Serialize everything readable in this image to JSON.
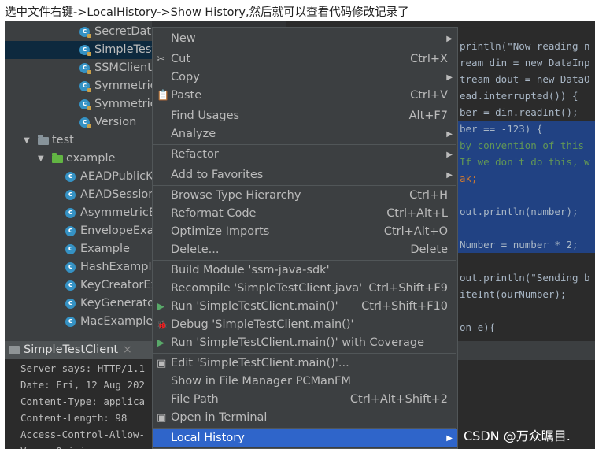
{
  "caption": "选中文件右键->LocalHistory->Show History,然后就可以查看代码修改记录了",
  "tree": {
    "items": [
      {
        "label": "SecretData",
        "kind": "class",
        "lock": true,
        "selected": false
      },
      {
        "label": "SimpleTest",
        "kind": "class",
        "lock": true,
        "selected": true
      },
      {
        "label": "SSMClient",
        "kind": "class",
        "lock": true,
        "selected": false
      },
      {
        "label": "Symmetric",
        "kind": "class",
        "lock": true,
        "selected": false
      },
      {
        "label": "Symmetric",
        "kind": "class",
        "lock": true,
        "selected": false
      },
      {
        "label": "Version",
        "kind": "class",
        "lock": true,
        "selected": false
      },
      {
        "label": "test",
        "kind": "folder",
        "expanded": true
      },
      {
        "label": "example",
        "kind": "folder",
        "expanded": true
      },
      {
        "label": "AEADPublicK",
        "kind": "class",
        "lock": false
      },
      {
        "label": "AEADSession",
        "kind": "class",
        "lock": false
      },
      {
        "label": "AsymmetricE",
        "kind": "class",
        "lock": false
      },
      {
        "label": "EnvelopeExar",
        "kind": "class",
        "lock": false
      },
      {
        "label": "Example",
        "kind": "class",
        "lock": false
      },
      {
        "label": "HashExample",
        "kind": "class",
        "lock": false
      },
      {
        "label": "KeyCreatorEx",
        "kind": "class",
        "lock": false
      },
      {
        "label": "KeyGenerator",
        "kind": "class",
        "lock": false
      },
      {
        "label": "MacExample",
        "kind": "class",
        "lock": false
      }
    ]
  },
  "code": {
    "lines": [
      "println(\"Now reading n",
      "ream din = new DataInp",
      "tream dout = new DataO",
      "ead.interrupted()) {",
      "ber = din.readInt();",
      "ber == -123) {",
      "by convention of this",
      "If we don't do this, w",
      "ak;",
      "",
      "out.println(number);",
      "",
      "Number = number * 2;",
      "",
      "out.println(\"Sending b",
      "iteInt(ourNumber);",
      "",
      "on e){"
    ]
  },
  "run_panel": {
    "tab_label": "SimpleTestClient",
    "close": "×",
    "console": [
      "Server says: HTTP/1.1",
      "Date: Fri, 12 Aug 202",
      "Content-Type: applica",
      "Content-Length: 98",
      "Access-Control-Allow-",
      "Vary: Origin"
    ]
  },
  "menu": {
    "items": [
      {
        "label": "New",
        "shortcut": "",
        "submenu": true
      },
      {
        "label": "Cut",
        "shortcut": "Ctrl+X",
        "icon": "✂"
      },
      {
        "label": "Copy",
        "shortcut": "",
        "submenu": true
      },
      {
        "label": "Paste",
        "shortcut": "Ctrl+V",
        "icon": "📋"
      },
      {
        "label": "Find Usages",
        "shortcut": "Alt+F7"
      },
      {
        "label": "Analyze",
        "shortcut": "",
        "submenu": true
      },
      {
        "label": "Refactor",
        "shortcut": "",
        "submenu": true
      },
      {
        "label": "Add to Favorites",
        "shortcut": "",
        "submenu": true
      },
      {
        "label": "Browse Type Hierarchy",
        "shortcut": "Ctrl+H"
      },
      {
        "label": "Reformat Code",
        "shortcut": "Ctrl+Alt+L"
      },
      {
        "label": "Optimize Imports",
        "shortcut": "Ctrl+Alt+O"
      },
      {
        "label": "Delete...",
        "shortcut": "Delete"
      },
      {
        "label": "Build Module 'ssm-java-sdk'",
        "shortcut": ""
      },
      {
        "label": "Recompile 'SimpleTestClient.java'",
        "shortcut": "Ctrl+Shift+F9"
      },
      {
        "label": "Run 'SimpleTestClient.main()'",
        "shortcut": "Ctrl+Shift+F10",
        "icon": "▶"
      },
      {
        "label": "Debug 'SimpleTestClient.main()'",
        "shortcut": "",
        "icon": "🐞"
      },
      {
        "label": "Run 'SimpleTestClient.main()' with Coverage",
        "shortcut": "",
        "icon": "▶"
      },
      {
        "label": "Edit 'SimpleTestClient.main()'...",
        "shortcut": "",
        "icon": "▣"
      },
      {
        "label": "Show in File Manager PCManFM",
        "shortcut": ""
      },
      {
        "label": "File Path",
        "shortcut": "Ctrl+Alt+Shift+2"
      },
      {
        "label": "Open in Terminal",
        "shortcut": "",
        "icon": "▣"
      },
      {
        "label": "Local History",
        "shortcut": "",
        "submenu": true,
        "active": true
      }
    ]
  },
  "watermark": "CSDN @万众瞩目.",
  "colors": {
    "tree_bg": "#3c3f41",
    "editor_bg": "#2b2b2b",
    "selection": "#214283",
    "menu_active": "#2f65ca",
    "class_icon": "#3592c4",
    "keyword": "#cc7832",
    "comment": "#629755"
  }
}
